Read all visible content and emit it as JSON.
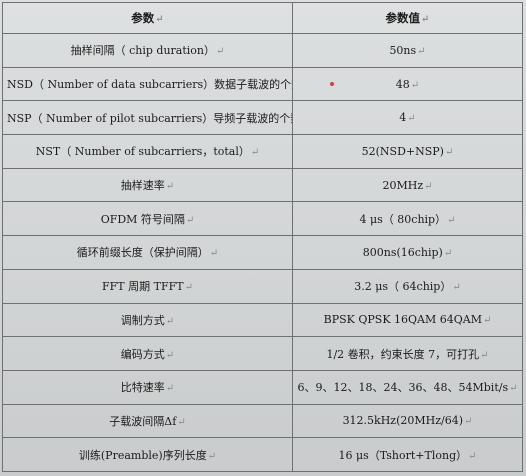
{
  "table": {
    "headers": [
      "参数",
      "参数值"
    ],
    "paragraph_mark": "↵",
    "rows": [
      {
        "param": "抽样间隔（ chip duration）",
        "value": "50ns"
      },
      {
        "param": "NSD（ Number of data subcarriers）数据子载波的个数",
        "value": "48"
      },
      {
        "param": "NSP（ Number of pilot subcarriers）导频子载波的个数",
        "value": "4"
      },
      {
        "param": "NST（ Number of subcarriers，total）",
        "value": "52(NSD+NSP)"
      },
      {
        "param": "抽样速率",
        "value": "20MHz"
      },
      {
        "param": "OFDM 符号间隔",
        "value": "4 μs（ 80chip）"
      },
      {
        "param": "循环前缀长度（保护间隔）",
        "value": "800ns(16chip)"
      },
      {
        "param": "FFT 周期 TFFT",
        "value": "3.2 μs（ 64chip）"
      },
      {
        "param": "调制方式",
        "value": "BPSK QPSK 16QAM 64QAM"
      },
      {
        "param": "编码方式",
        "value": "1/2 卷积，约束长度 7，可打孔"
      },
      {
        "param": "比特速率",
        "value": "6、9、12、18、24、36、48、54Mbit/s"
      },
      {
        "param": "子载波间隔Δf",
        "value": "312.5kHz(20MHz/64)"
      },
      {
        "param": "训练(Preamble)序列长度",
        "value": "16 μs（Tshort+Tlong）"
      }
    ]
  },
  "colors": {
    "background": "#d2d5d6",
    "border": "#6e7173",
    "text": "#1b1b1b",
    "dot": "#e23a3a"
  }
}
